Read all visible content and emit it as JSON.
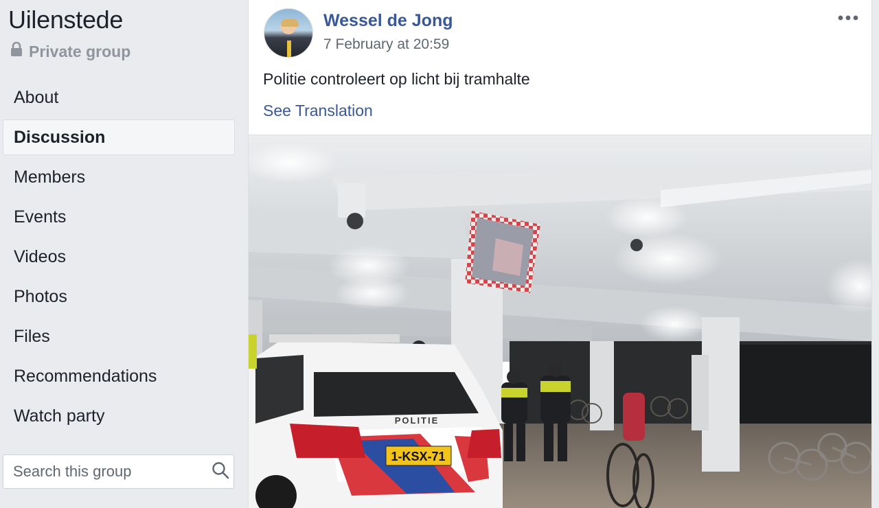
{
  "group": {
    "name": "Uilenstede",
    "privacy_label": "Private group",
    "privacy_icon": "lock-icon"
  },
  "nav": {
    "items": [
      {
        "label": "About"
      },
      {
        "label": "Discussion",
        "active": true
      },
      {
        "label": "Members"
      },
      {
        "label": "Events"
      },
      {
        "label": "Videos"
      },
      {
        "label": "Photos"
      },
      {
        "label": "Files"
      },
      {
        "label": "Recommendations"
      },
      {
        "label": "Watch party"
      }
    ]
  },
  "search": {
    "placeholder": "Search this group",
    "icon": "search-icon"
  },
  "post": {
    "author": "Wessel de Jong",
    "timestamp": "7 February at 20:59",
    "text": "Politie controleert op licht bij tramhalte",
    "translation_link": "See Translation",
    "menu_icon": "more-options-icon",
    "photo": {
      "plate": "1-KSX-71",
      "vehicle_text": "POLITIE"
    }
  },
  "colors": {
    "link": "#385898",
    "background": "#e9ebee",
    "secondary_text": "#606770",
    "muted_text": "#90949c"
  }
}
